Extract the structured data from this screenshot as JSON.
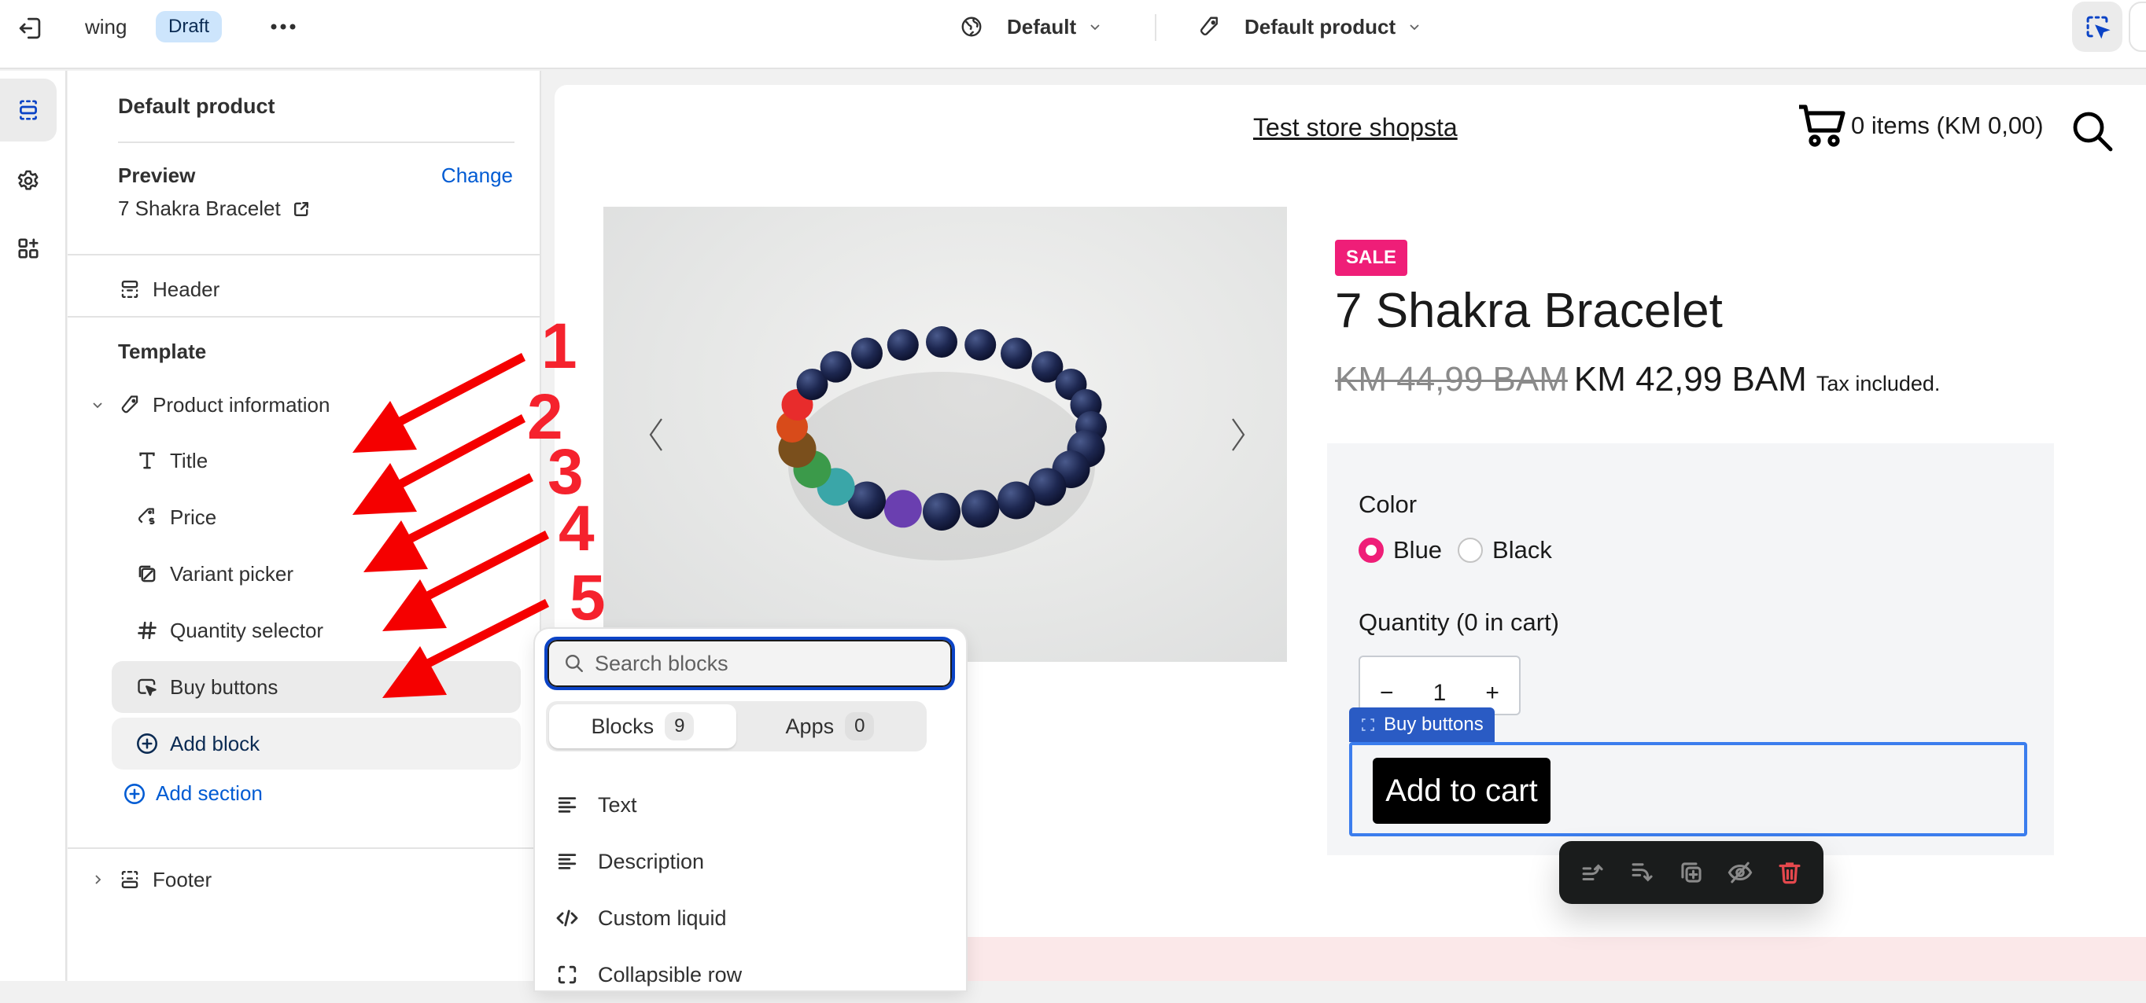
{
  "topbar": {
    "theme_name": "wing",
    "status_badge": "Draft",
    "more_label": "•••",
    "context_selector": "Default",
    "template_selector": "Default product"
  },
  "rail": {
    "items": [
      {
        "name": "sections",
        "icon": "sections-icon",
        "active": true
      },
      {
        "name": "theme-settings",
        "icon": "gear-icon",
        "active": false
      },
      {
        "name": "app-embeds",
        "icon": "apps-add-icon",
        "active": false
      }
    ]
  },
  "sidebar": {
    "title": "Default product",
    "preview_label": "Preview",
    "change_link": "Change",
    "preview_product": "7 Shakra Bracelet",
    "header_section": "Header",
    "template_label": "Template",
    "product_info_section": "Product information",
    "blocks": [
      {
        "label": "Title",
        "icon": "text-title-icon"
      },
      {
        "label": "Price",
        "icon": "price-tag-icon"
      },
      {
        "label": "Variant picker",
        "icon": "variant-icon"
      },
      {
        "label": "Quantity selector",
        "icon": "hash-icon"
      },
      {
        "label": "Buy buttons",
        "icon": "cursor-button-icon",
        "selected": true
      }
    ],
    "add_block": "Add block",
    "add_section": "Add section",
    "footer_section": "Footer"
  },
  "block_picker": {
    "search_placeholder": "Search blocks",
    "search_value": "",
    "tabs": [
      {
        "label": "Blocks",
        "count": "9",
        "active": true
      },
      {
        "label": "Apps",
        "count": "0",
        "active": false
      }
    ],
    "items": [
      {
        "label": "Text",
        "icon": "text-lines-icon"
      },
      {
        "label": "Description",
        "icon": "text-lines-icon"
      },
      {
        "label": "Custom liquid",
        "icon": "code-icon"
      },
      {
        "label": "Collapsible row",
        "icon": "collapsible-icon"
      }
    ]
  },
  "store": {
    "name": "Test store shopsta",
    "cart_summary": "0 items (KM 0,00)",
    "product": {
      "badge": "SALE",
      "title": "7 Shakra Bracelet",
      "compare_price": "KM 44,99 BAM",
      "price": "KM 42,99 BAM",
      "tax_note": "Tax included.",
      "option_label": "Color",
      "options": [
        {
          "label": "Blue",
          "selected": true
        },
        {
          "label": "Black",
          "selected": false
        }
      ],
      "quantity_label": "Quantity (0 in cart)",
      "quantity": "1",
      "qty_minus": "−",
      "qty_plus": "+",
      "add_to_cart": "Add to cart"
    },
    "selected_block_tag": "Buy buttons"
  },
  "colors": {
    "accent_blue": "#005bd3",
    "sale_pink": "#ef1e78",
    "selection_blue": "#3b7ded",
    "delete_red": "#e5484d",
    "annotation_red": "#f5222d"
  },
  "annotations": [
    "1",
    "2",
    "3",
    "4",
    "5"
  ]
}
